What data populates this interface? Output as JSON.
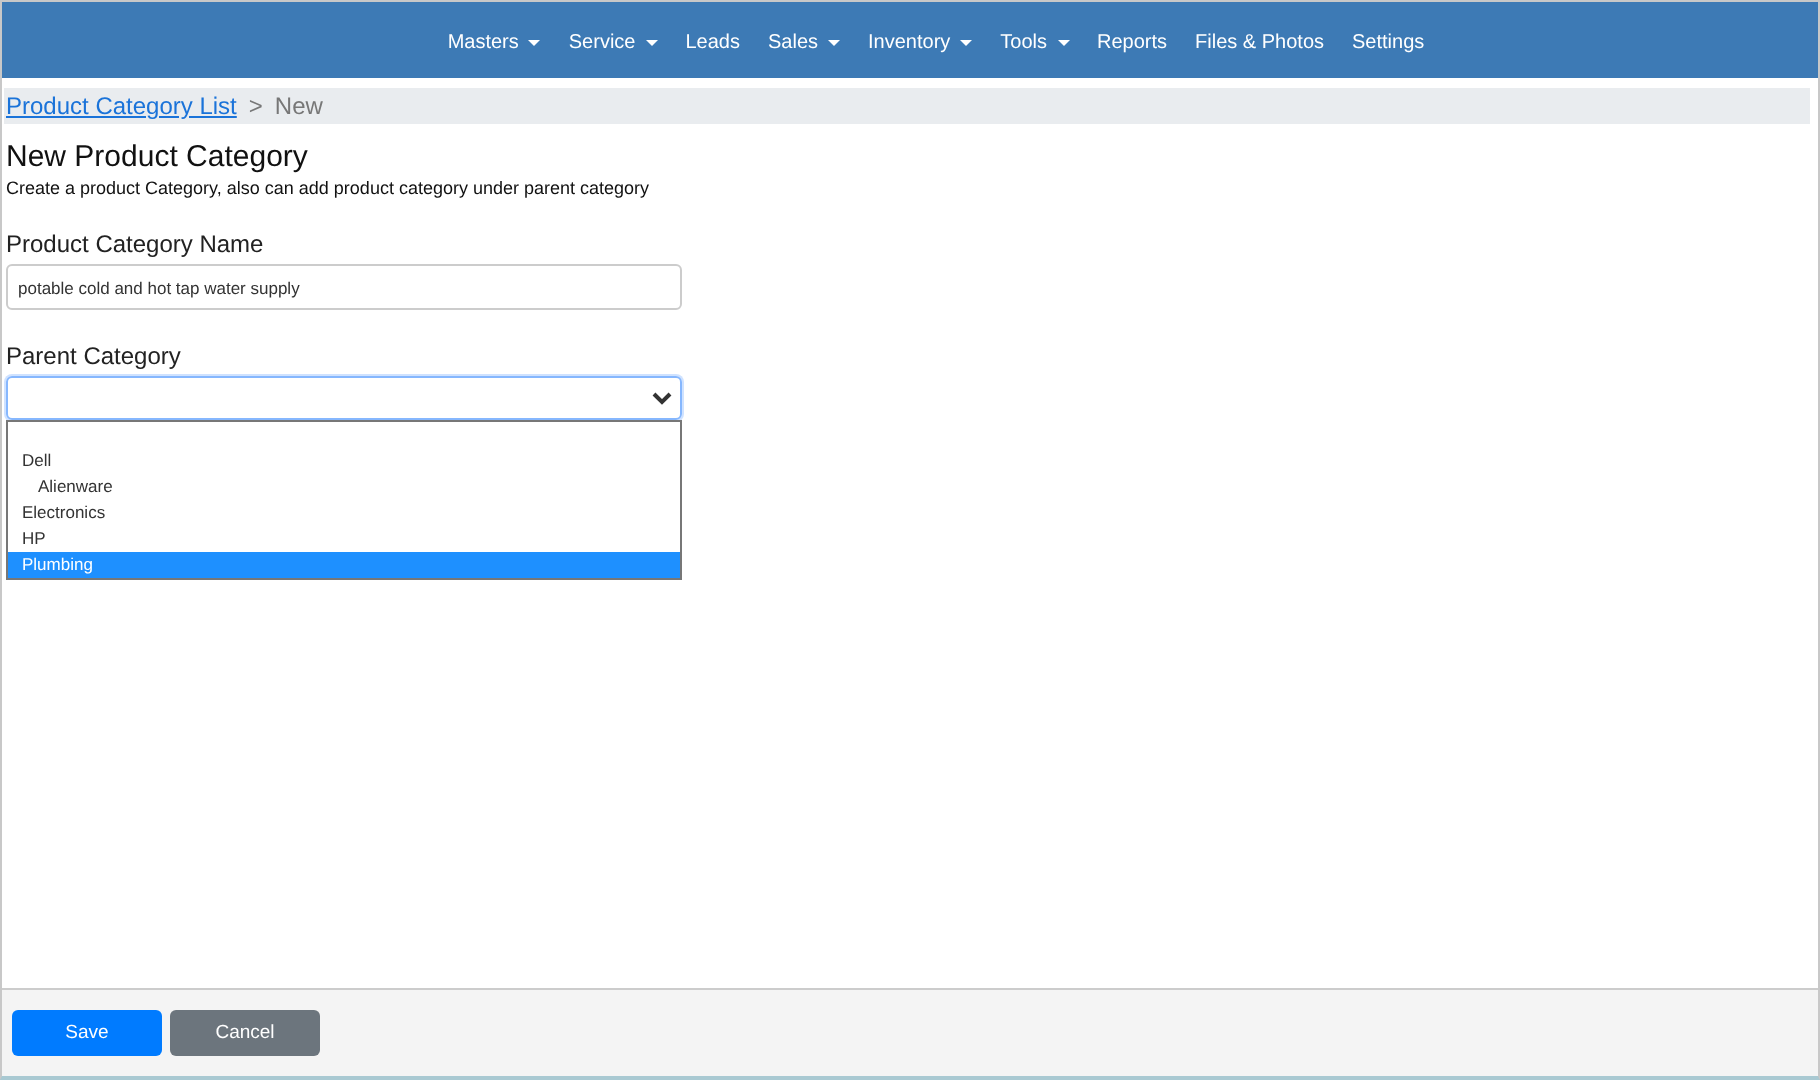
{
  "nav": [
    {
      "label": "Masters",
      "dropdown": true
    },
    {
      "label": "Service",
      "dropdown": true
    },
    {
      "label": "Leads",
      "dropdown": false
    },
    {
      "label": "Sales",
      "dropdown": true
    },
    {
      "label": "Inventory",
      "dropdown": true
    },
    {
      "label": "Tools",
      "dropdown": true
    },
    {
      "label": "Reports",
      "dropdown": false
    },
    {
      "label": "Files & Photos",
      "dropdown": false
    },
    {
      "label": "Settings",
      "dropdown": false
    }
  ],
  "breadcrumb": {
    "link": "Product Category List",
    "separator": ">",
    "current": "New"
  },
  "title": "New Product Category",
  "description": "Create a product Category, also can add product category under parent category",
  "name_field": {
    "label": "Product Category Name",
    "value": "potable cold and hot tap water supply"
  },
  "parent_field": {
    "label": "Parent Category",
    "expanded": true,
    "options": [
      {
        "label": "Dell",
        "selected": false,
        "children": [
          {
            "label": "Alienware",
            "selected": false
          }
        ]
      },
      {
        "label": "Electronics",
        "selected": false
      },
      {
        "label": "HP",
        "selected": false
      },
      {
        "label": "Plumbing",
        "selected": true
      }
    ]
  },
  "buttons": [
    {
      "label": "Save",
      "kind": "primary"
    },
    {
      "label": "Cancel",
      "kind": "secondary"
    }
  ]
}
